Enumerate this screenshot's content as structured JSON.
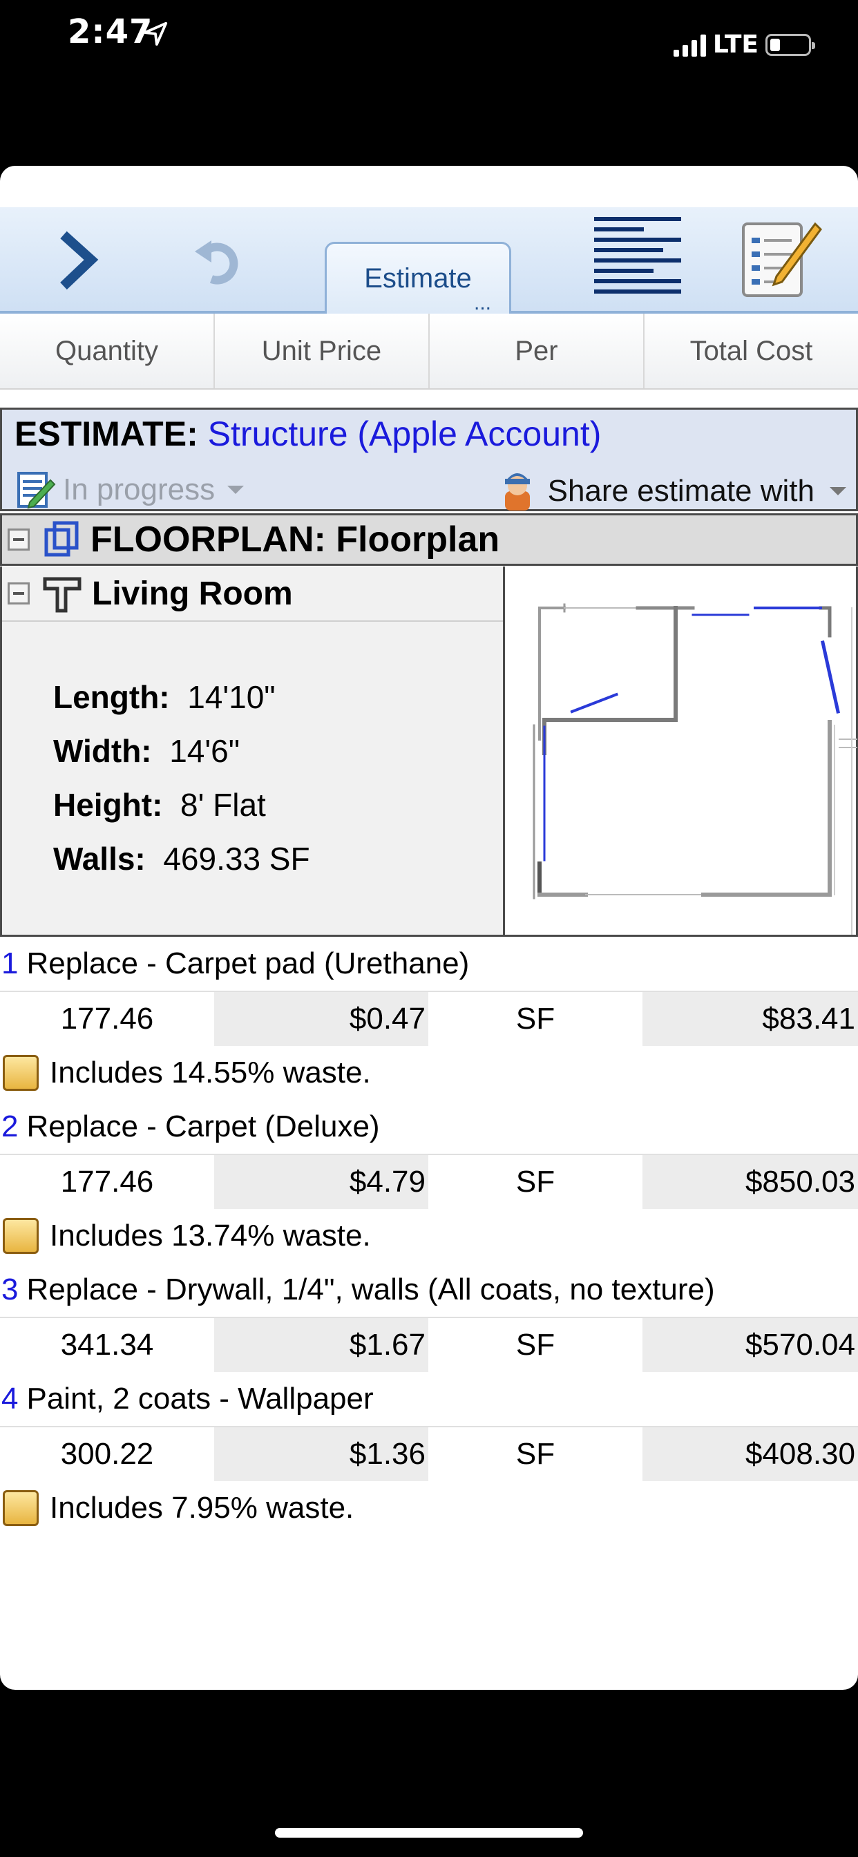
{
  "status_bar": {
    "time": "2:47",
    "network": "LTE"
  },
  "toolbar": {
    "tab_label": "Estimate",
    "tab_more": "..."
  },
  "columns": [
    "Quantity",
    "Unit Price",
    "Per",
    "Total Cost"
  ],
  "estimate": {
    "label": "ESTIMATE:",
    "name": "Structure (Apple Account)",
    "status": "In progress",
    "share_label": "Share estimate with"
  },
  "floorplan": {
    "title": "FLOORPLAN: Floorplan"
  },
  "room": {
    "name": "Living Room",
    "length_label": "Length:",
    "length": "14'10\"",
    "width_label": "Width:",
    "width": "14'6\"",
    "height_label": "Height:",
    "height": "8' Flat",
    "walls_label": "Walls:",
    "walls": "469.33 SF"
  },
  "line_items": [
    {
      "num": "1",
      "desc": "Replace - Carpet pad (Urethane)",
      "qty": "177.46",
      "price": "$0.47",
      "per": "SF",
      "total": "$83.41",
      "note": "Includes 14.55% waste."
    },
    {
      "num": "2",
      "desc": "Replace - Carpet (Deluxe)",
      "qty": "177.46",
      "price": "$4.79",
      "per": "SF",
      "total": "$850.03",
      "note": "Includes 13.74% waste."
    },
    {
      "num": "3",
      "desc": "Replace - Drywall, 1/4\", walls (All coats, no texture)",
      "qty": "341.34",
      "price": "$1.67",
      "per": "SF",
      "total": "$570.04",
      "note": ""
    },
    {
      "num": "4",
      "desc": "Paint, 2 coats - Wallpaper",
      "qty": "300.22",
      "price": "$1.36",
      "per": "SF",
      "total": "$408.30",
      "note": "Includes 7.95% waste."
    }
  ],
  "icons": {
    "forward": "chevron-right-icon",
    "undo": "undo-icon",
    "lines": "lines-icon",
    "notes": "notepad-pencil-icon"
  }
}
